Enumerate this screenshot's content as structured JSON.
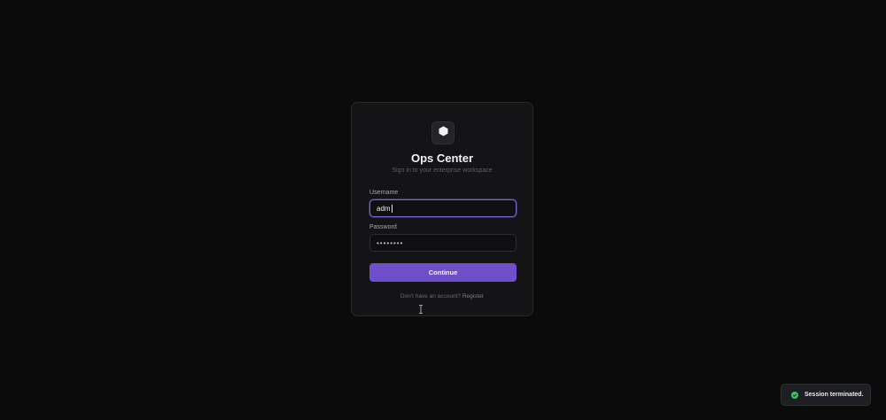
{
  "app": {
    "title": "Ops Center",
    "subtitle": "Sign in to your enterprise workspace",
    "logo_icon": "cube-icon"
  },
  "form": {
    "username_label": "Username",
    "username_value": "adm",
    "password_label": "Password",
    "password_value": "••••••••",
    "submit_label": "Continue"
  },
  "footer": {
    "prompt": "Don't have an account?",
    "register_label": "Register"
  },
  "toast": {
    "message": "Session terminated.",
    "icon": "check-circle-icon",
    "status_color": "#3ac26a"
  },
  "colors": {
    "accent": "#6f4fc9",
    "focus_ring": "#7a64d6",
    "background": "#0b0b0c"
  }
}
